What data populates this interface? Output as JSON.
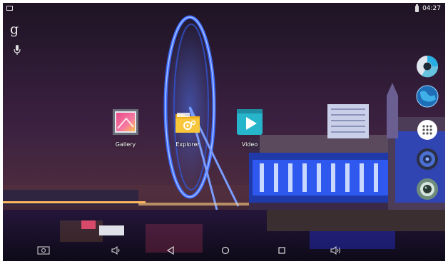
{
  "status_bar": {
    "time": "04:27"
  },
  "home": {
    "search_glyph": "g",
    "apps": [
      {
        "label": "Gallery"
      },
      {
        "label": "Explorer"
      },
      {
        "label": "Video"
      }
    ],
    "right_dock": [
      "chrome-like-icon",
      "globe-icon",
      "app-drawer-icon",
      "speaker-icon",
      "camera-lens-icon"
    ]
  },
  "nav_bar": [
    "screenshot-icon",
    "volume-down-icon",
    "back-icon",
    "home-icon",
    "recents-icon",
    "volume-up-icon"
  ]
}
